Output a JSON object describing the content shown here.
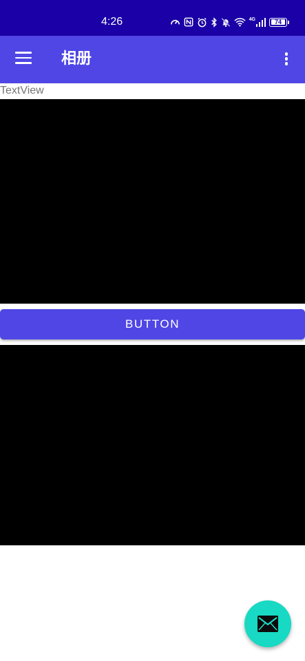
{
  "status_bar": {
    "time": "4:26",
    "network_label": "4G",
    "battery_level": "74",
    "icons": [
      "speed-icon",
      "nfc-icon",
      "alarm-icon",
      "bluetooth-icon",
      "mute-icon",
      "wifi-icon",
      "signal-icon",
      "battery-icon"
    ]
  },
  "toolbar": {
    "title": "相册",
    "menu_icon": "menu-icon",
    "overflow_icon": "more-vert-icon"
  },
  "content": {
    "text_view": "TextView",
    "button_label": "BUTTON"
  },
  "fab": {
    "icon": "mail-icon"
  },
  "colors": {
    "status_bar": "#1a00a6",
    "primary": "#4f46e5",
    "accent": "#18d9c3",
    "image_placeholder": "#000000",
    "text_secondary": "#757575"
  }
}
